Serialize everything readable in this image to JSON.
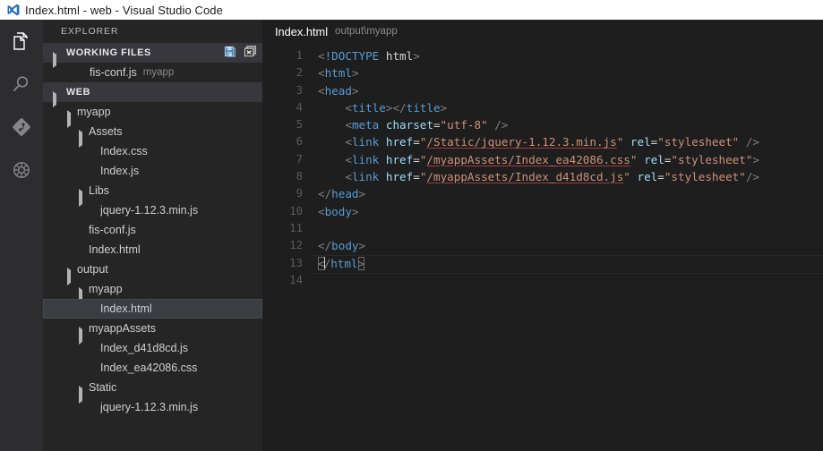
{
  "window": {
    "title": "Index.html - web - Visual Studio Code",
    "logo_icon": "vscode-logo-icon"
  },
  "activity_bar": {
    "items": [
      {
        "name": "explorer",
        "icon": "files-icon",
        "active": true
      },
      {
        "name": "search",
        "icon": "search-icon",
        "active": false
      },
      {
        "name": "source-control",
        "icon": "source-control-icon",
        "active": false
      },
      {
        "name": "debug",
        "icon": "debug-icon",
        "active": false
      }
    ]
  },
  "sidebar": {
    "title": "EXPLORER",
    "working_files": {
      "label": "WORKING FILES",
      "actions": [
        {
          "name": "save-all-icon",
          "title": "Save All"
        },
        {
          "name": "close-all-icon",
          "title": "Close All"
        }
      ],
      "items": [
        {
          "label": "fis-conf.js",
          "path": "myapp",
          "indent": 2,
          "type": "file"
        }
      ]
    },
    "web": {
      "label": "WEB",
      "items": [
        {
          "label": "myapp",
          "indent": 2,
          "type": "folder",
          "expanded": true
        },
        {
          "label": "Assets",
          "indent": 3,
          "type": "folder",
          "expanded": true
        },
        {
          "label": "Index.css",
          "indent": 4,
          "type": "file"
        },
        {
          "label": "Index.js",
          "indent": 4,
          "type": "file"
        },
        {
          "label": "Libs",
          "indent": 3,
          "type": "folder",
          "expanded": true
        },
        {
          "label": "jquery-1.12.3.min.js",
          "indent": 4,
          "type": "file"
        },
        {
          "label": "fis-conf.js",
          "indent": 3,
          "type": "file"
        },
        {
          "label": "Index.html",
          "indent": 3,
          "type": "file"
        },
        {
          "label": "output",
          "indent": 2,
          "type": "folder",
          "expanded": true
        },
        {
          "label": "myapp",
          "indent": 3,
          "type": "folder",
          "expanded": true
        },
        {
          "label": "Index.html",
          "indent": 4,
          "type": "file",
          "selected": true
        },
        {
          "label": "myappAssets",
          "indent": 3,
          "type": "folder",
          "expanded": true
        },
        {
          "label": "Index_d41d8cd.js",
          "indent": 4,
          "type": "file"
        },
        {
          "label": "Index_ea42086.css",
          "indent": 4,
          "type": "file"
        },
        {
          "label": "Static",
          "indent": 3,
          "type": "folder",
          "expanded": true
        },
        {
          "label": "jquery-1.12.3.min.js",
          "indent": 4,
          "type": "file"
        }
      ]
    }
  },
  "editor": {
    "tab": {
      "name": "Index.html",
      "path": "output\\myapp"
    },
    "line_numbers": [
      "1",
      "2",
      "3",
      "4",
      "5",
      "6",
      "7",
      "8",
      "9",
      "10",
      "11",
      "12",
      "13",
      "14"
    ],
    "lines": [
      {
        "n": 1,
        "text": "<!DOCTYPE html>"
      },
      {
        "n": 2,
        "text": "<html>"
      },
      {
        "n": 3,
        "text": "<head>"
      },
      {
        "n": 4,
        "text": "    <title></title>"
      },
      {
        "n": 5,
        "text": "    <meta charset=\"utf-8\" />"
      },
      {
        "n": 6,
        "text": "    <link href=\"/Static/jquery-1.12.3.min.js\" rel=\"stylesheet\" />"
      },
      {
        "n": 7,
        "text": "    <link href=\"/myappAssets/Index_ea42086.css\" rel=\"stylesheet\">"
      },
      {
        "n": 8,
        "text": "    <link href=\"/myappAssets/Index_d41d8cd.js\" rel=\"stylesheet\"/>"
      },
      {
        "n": 9,
        "text": "</head>"
      },
      {
        "n": 10,
        "text": "<body>"
      },
      {
        "n": 11,
        "text": ""
      },
      {
        "n": 12,
        "text": "</body>"
      },
      {
        "n": 13,
        "text": "</html>",
        "current": true
      },
      {
        "n": 14,
        "text": ""
      }
    ],
    "tokens": {
      "doctype_keyword": "!DOCTYPE",
      "doctype_value": "html",
      "tag_html": "html",
      "tag_head": "head",
      "tag_title": "title",
      "tag_meta": "meta",
      "tag_link": "link",
      "tag_body": "body",
      "attr_charset": "charset",
      "attr_href": "href",
      "attr_rel": "rel",
      "value_utf8": "\"utf-8\"",
      "value_stylesheet": "\"stylesheet\"",
      "href_1": "/Static/jquery-1.12.3.min.js",
      "href_2": "/myappAssets/Index_ea42086.css",
      "href_3": "/myappAssets/Index_d41d8cd.js"
    }
  },
  "colors": {
    "titlebar_bg": "#ffffff",
    "activitybar_bg": "#2d2d30",
    "sidebar_bg": "#252526",
    "editor_bg": "#1e1e1e",
    "section_header_bg": "#37373d",
    "selection_bg": "#3a3d41",
    "tag": "#569cd6",
    "attribute": "#9cdcfe",
    "string": "#ce9178",
    "punctuation": "#808080",
    "link_underline": "#a33a3a",
    "accent": "#0065a9"
  }
}
